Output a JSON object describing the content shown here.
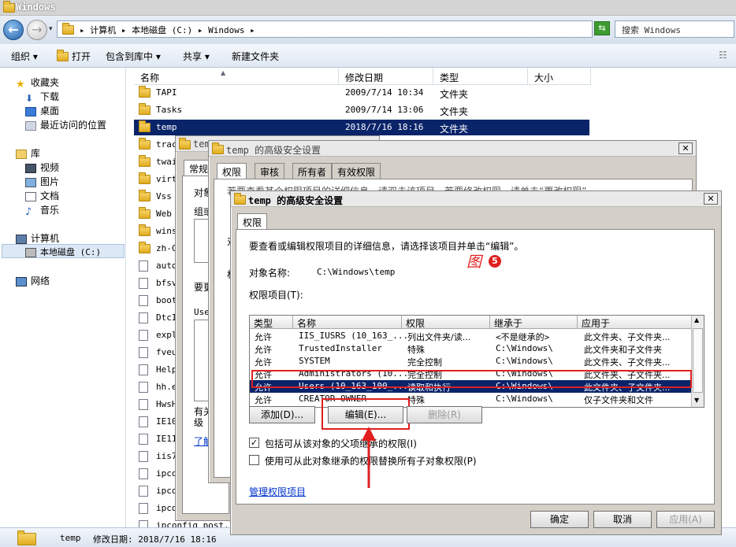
{
  "explorer": {
    "title": "Windows",
    "breadcrumb": "▸ 计算机 ▸ 本地磁盘 (C:) ▸ Windows ▸",
    "search_placeholder": "搜索 Windows",
    "toolbar": {
      "organize": "组织 ▾",
      "open": "打开",
      "include_library": "包含到库中 ▾",
      "share": "共享 ▾",
      "new_folder": "新建文件夹"
    },
    "nav": {
      "favorites": "收藏夹",
      "downloads": "下载",
      "desktop": "桌面",
      "recent": "最近访问的位置",
      "libraries": "库",
      "videos": "视频",
      "pictures": "图片",
      "documents": "文档",
      "music": "音乐",
      "computer": "计算机",
      "local_disk": "本地磁盘 (C:)",
      "network": "网络"
    },
    "columns": {
      "name": "名称",
      "date": "修改日期",
      "type": "类型",
      "size": "大小"
    },
    "files": [
      {
        "name": "TAPI",
        "date": "2009/7/14 10:34",
        "type": "文件夹"
      },
      {
        "name": "Tasks",
        "date": "2009/7/14 13:06",
        "type": "文件夹"
      },
      {
        "name": "temp",
        "date": "2018/7/16 18:16",
        "type": "文件夹"
      },
      {
        "name": "trac",
        "date": "",
        "type": ""
      },
      {
        "name": "twai",
        "date": "",
        "type": ""
      },
      {
        "name": "virt",
        "date": "",
        "type": ""
      },
      {
        "name": "Vss",
        "date": "",
        "type": ""
      },
      {
        "name": "Web",
        "date": "",
        "type": ""
      },
      {
        "name": "wins",
        "date": "",
        "type": ""
      },
      {
        "name": "zh-C",
        "date": "",
        "type": ""
      },
      {
        "name": "auto",
        "date": "",
        "type": ""
      },
      {
        "name": "bfsv",
        "date": "",
        "type": ""
      },
      {
        "name": "boot",
        "date": "",
        "type": ""
      },
      {
        "name": "DtcI",
        "date": "",
        "type": ""
      },
      {
        "name": "expl",
        "date": "",
        "type": ""
      },
      {
        "name": "fveu",
        "date": "",
        "type": ""
      },
      {
        "name": "Help",
        "date": "",
        "type": ""
      },
      {
        "name": "hh.e",
        "date": "",
        "type": ""
      },
      {
        "name": "HwsH",
        "date": "",
        "type": ""
      },
      {
        "name": "IE10",
        "date": "",
        "type": ""
      },
      {
        "name": "IE11",
        "date": "",
        "type": ""
      },
      {
        "name": "iis7",
        "date": "",
        "type": ""
      },
      {
        "name": "ipco",
        "date": "",
        "type": ""
      },
      {
        "name": "ipconfig_devconf",
        "date": "",
        "type": ""
      },
      {
        "name": "ipconfig_post.ba",
        "date": "",
        "type": ""
      },
      {
        "name": "ipconfig_post.lo",
        "date": "",
        "type": ""
      }
    ],
    "status": {
      "name": "temp",
      "date_label": "修改日期: 2018/7/16 18:16"
    }
  },
  "props_dialog": {
    "title": "temp",
    "tabs": [
      "常规"
    ],
    "fragments": [
      "对象",
      "组或",
      "要更",
      "User",
      "有关",
      "级",
      "了解",
      "管"
    ]
  },
  "adv_dialog_back": {
    "title": "temp 的高级安全设置",
    "tabs": [
      "权限",
      "审核",
      "所有者",
      "有效权限"
    ],
    "intro": "若要查看某个权限项目的详细信息，请双击该项目。若要修改权限，请单击“更改权限”。",
    "fragments": [
      "对",
      "权"
    ]
  },
  "adv_dialog": {
    "title": "temp 的高级安全设置",
    "tab": "权限",
    "description": "要查看或编辑权限项目的详细信息，请选择该项目并单击“编辑”。",
    "object_name_label": "对象名称:",
    "object_name_value": "C:\\Windows\\temp",
    "annotation": "图",
    "annotation_number": "5",
    "entries_label": "权限项目(T):",
    "columns": [
      "类型",
      "名称",
      "权限",
      "继承于",
      "应用于"
    ],
    "rows": [
      {
        "type": "允许",
        "name": "IIS_IUSRS (10_163_...",
        "perm": "列出文件夹/读...",
        "inherit": "<不是继承的>",
        "apply": "此文件夹、子文件夹..."
      },
      {
        "type": "允许",
        "name": "TrustedInstaller",
        "perm": "特殊",
        "inherit": "C:\\Windows\\",
        "apply": "此文件夹和子文件夹"
      },
      {
        "type": "允许",
        "name": "SYSTEM",
        "perm": "完全控制",
        "inherit": "C:\\Windows\\",
        "apply": "此文件夹、子文件夹..."
      },
      {
        "type": "允许",
        "name": "Administrators (10...",
        "perm": "完全控制",
        "inherit": "C:\\Windows\\",
        "apply": "此文件夹、子文件夹..."
      },
      {
        "type": "允许",
        "name": "Users (10_163_100_...",
        "perm": "读取和执行",
        "inherit": "C:\\Windows\\",
        "apply": "此文件夹、子文件夹..."
      },
      {
        "type": "允许",
        "name": "CREATOR OWNER",
        "perm": "特殊",
        "inherit": "C:\\Windows\\",
        "apply": "仅子文件夹和文件"
      }
    ],
    "buttons": {
      "add": "添加(D)...",
      "edit": "编辑(E)...",
      "remove": "删除(R)"
    },
    "include_inherit": "包括可从该对象的父项继承的权限(I)",
    "replace_child": "使用可从此对象继承的权限替换所有子对象权限(P)",
    "manage_link": "管理权限项目",
    "ok": "确定",
    "cancel": "取消",
    "apply": "应用(A)"
  },
  "colors": {
    "selection": "#0a246a",
    "highlight": "#e02020",
    "link": "#0033cc"
  }
}
